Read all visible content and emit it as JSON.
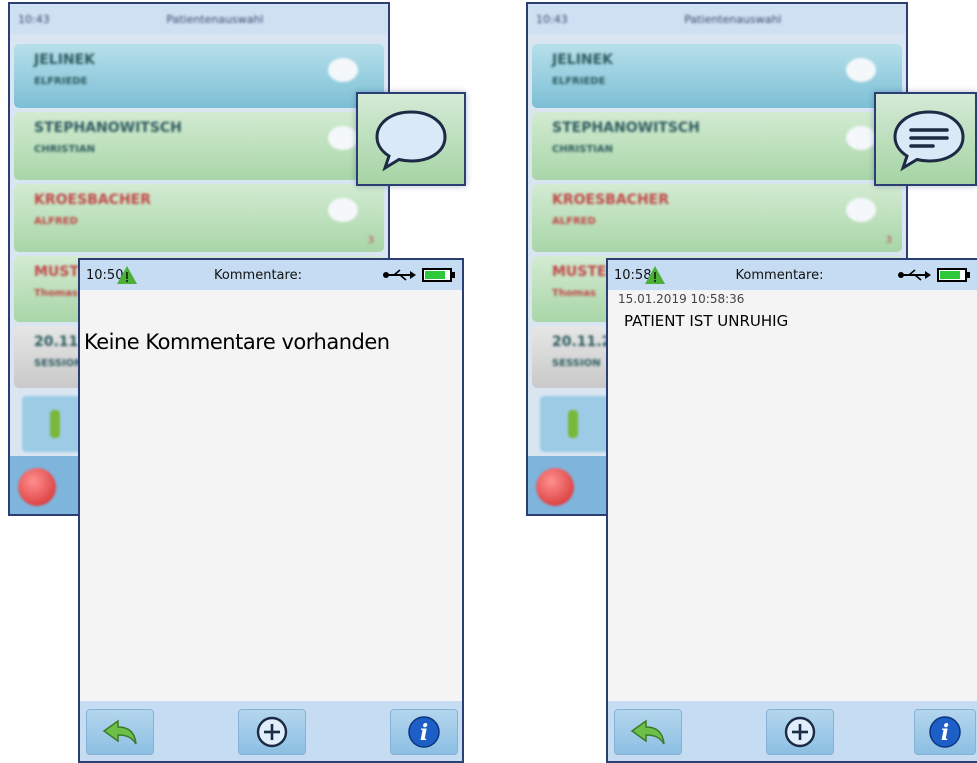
{
  "background_device": {
    "status": {
      "time": "10:43",
      "title": "Patientenauswahl"
    },
    "patients": [
      {
        "last": "JELINEK",
        "first": "ELFRIEDE",
        "style": "blue"
      },
      {
        "last": "STEPHANOWITSCH",
        "first": "CHRISTIAN",
        "style": "green"
      },
      {
        "last": "KROESBACHER",
        "first": "ALFRED",
        "style": "green-red",
        "count": "3"
      },
      {
        "last": "MUSTERMANN",
        "first": "Thomas",
        "style": "green-red"
      },
      {
        "last": "20.11.2018",
        "first": "SESSION",
        "style": "gray"
      }
    ]
  },
  "left_screen": {
    "status": {
      "time": "10:50",
      "title": "Kommentare:"
    },
    "empty_message": "Keine Kommentare vorhanden"
  },
  "right_screen": {
    "status": {
      "time": "10:58",
      "title": "Kommentare:"
    },
    "comments": [
      {
        "timestamp": "15.01.2019  10:58:36",
        "text": "PATIENT IST UNRUHIG"
      }
    ]
  },
  "buttons": {
    "back": "back-arrow-icon",
    "add": "add-circle-icon",
    "info": "info-icon"
  },
  "colors": {
    "accent_blue": "#2b3f73",
    "warn_green": "#4caf3a",
    "info_blue": "#1d5fc7",
    "battery_green": "#2ec93a"
  }
}
